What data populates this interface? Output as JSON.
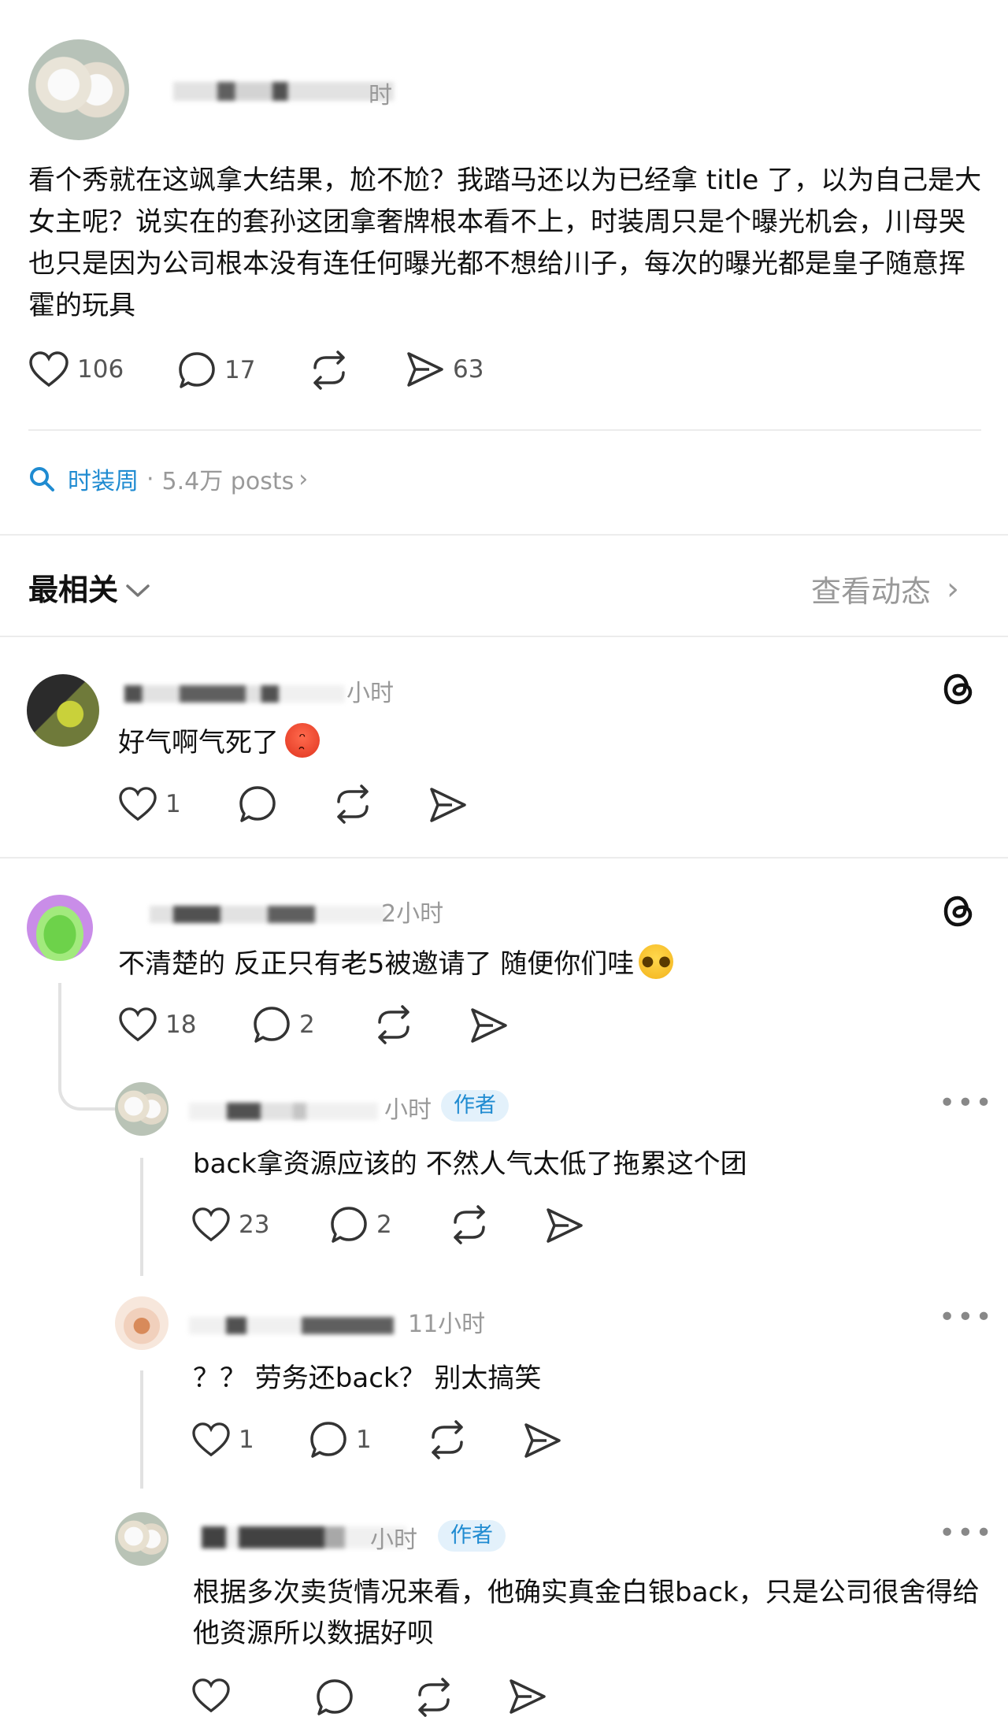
{
  "post": {
    "author": "",
    "time": "时",
    "text": "看个秀就在这飒拿大结果，尬不尬？我踏马还以为已经拿 title 了，以为自己是大女主呢？说实在的套孙这团拿奢牌根本看不上，时装周只是个曝光机会，川母哭也只是因为公司根本没有连任何曝光都不想给川子，每次的曝光都是皇子随意挥霍的玩具",
    "likes": "106",
    "comments": "17",
    "shares": "63"
  },
  "topic": {
    "name": "时装周",
    "separator": "·",
    "count": "5.4万 posts",
    "chevron": "›"
  },
  "sort": {
    "label": "最相关",
    "view_activity": "查看动态",
    "chevron": "›"
  },
  "comments": [
    {
      "time": "小时",
      "text": "好气啊气死了",
      "emoji": "😡",
      "likes": "1",
      "replies": ""
    },
    {
      "time": "2小时",
      "text": "不清楚的 反正只有老5被邀请了 随便你们哇",
      "emoji": "🥺",
      "likes": "18",
      "replies": "2",
      "nested": [
        {
          "time": "小时",
          "badge": "作者",
          "text": "back拿资源应该的 不然人气太低了拖累这个团",
          "likes": "23",
          "replies": "2"
        },
        {
          "time": "11小时",
          "badge": "",
          "text": "？？ 劳务还back？ 别太搞笑",
          "likes": "1",
          "replies": "1"
        },
        {
          "time": "小时",
          "badge": "作者",
          "text": "根据多次卖货情况来看，他确实真金白银back，只是公司很舍得给他资源所以数据好呗",
          "likes": "",
          "replies": ""
        }
      ]
    }
  ],
  "colors": {
    "accent": "#1f8bd1",
    "badge_bg": "#e3f1fb",
    "divider": "#ececec",
    "icon": "#555555",
    "angry_emoji": "#e8412c"
  },
  "icons": [
    "heart-icon",
    "comment-icon",
    "repost-icon",
    "share-icon",
    "search-icon",
    "threads-icon",
    "chevron-down-icon",
    "chevron-right-icon",
    "more-icon"
  ]
}
